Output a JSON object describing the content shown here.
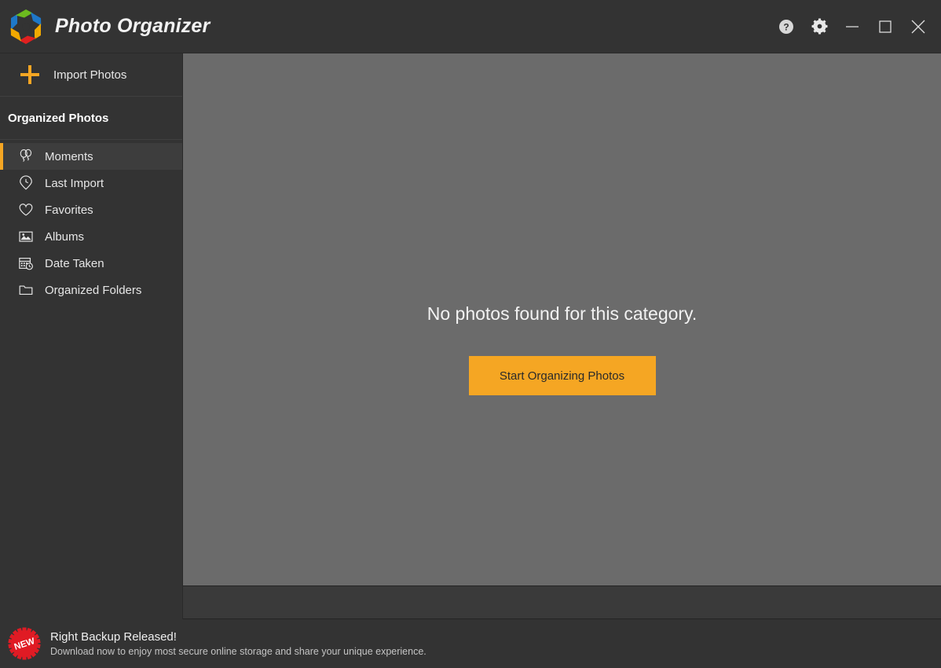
{
  "titlebar": {
    "app_title": "Photo Organizer",
    "logo_icon": "hexagon-photo-logo",
    "colors": {
      "blue": "#1e78c8",
      "green": "#6cbb1f",
      "yellow": "#f2a900",
      "red": "#e02020",
      "orange": "#f5a623"
    },
    "buttons": [
      {
        "name": "help-button",
        "icon": "help-circle-icon",
        "label": "?"
      },
      {
        "name": "settings-button",
        "icon": "gear-icon",
        "label": ""
      },
      {
        "name": "minimize-button",
        "icon": "minimize-icon",
        "label": ""
      },
      {
        "name": "maximize-button",
        "icon": "maximize-icon",
        "label": ""
      },
      {
        "name": "close-button",
        "icon": "close-icon",
        "label": ""
      }
    ]
  },
  "sidebar": {
    "import_label": "Import Photos",
    "import_icon": "plus-icon",
    "section_title": "Organized Photos",
    "items": [
      {
        "label": "Moments",
        "icon": "balloons-icon",
        "active": true
      },
      {
        "label": "Last Import",
        "icon": "clock-pin-icon",
        "active": false
      },
      {
        "label": "Favorites",
        "icon": "heart-icon",
        "active": false
      },
      {
        "label": "Albums",
        "icon": "image-icon",
        "active": false
      },
      {
        "label": "Date Taken",
        "icon": "calendar-clock-icon",
        "active": false
      },
      {
        "label": "Organized Folders",
        "icon": "folder-icon",
        "active": false
      }
    ]
  },
  "main": {
    "empty_message": "No photos found for this category.",
    "cta_label": "Start Organizing Photos",
    "accent_color": "#f5a623",
    "content_bg": "#6b6b6b"
  },
  "banner": {
    "badge_text": "NEW",
    "badge_color": "#e01b24",
    "title": "Right Backup Released!",
    "subtitle": "Download now to enjoy most secure online storage and share your unique experience."
  }
}
